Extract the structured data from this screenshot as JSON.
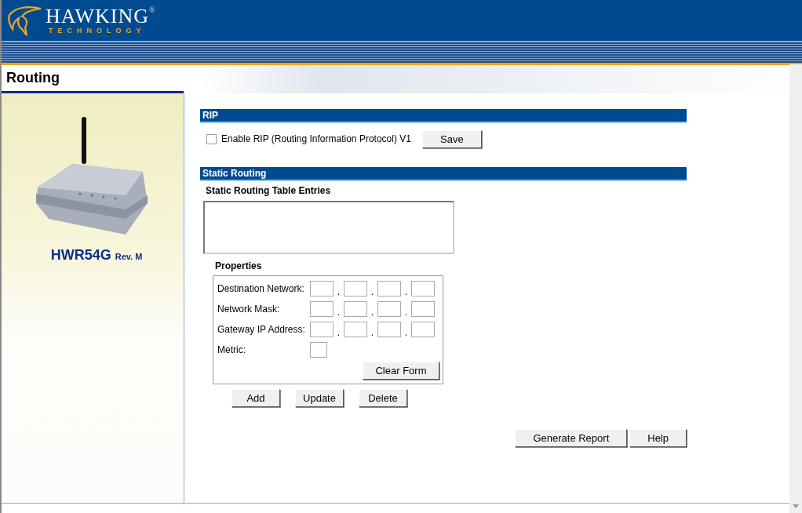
{
  "logo": {
    "brand": "HAWKING",
    "registered": "®",
    "sub": "TECHNOLOGY"
  },
  "page_title": "Routing",
  "device": {
    "model": "HWR54G",
    "revision": "Rev. M"
  },
  "rip": {
    "title": "RIP",
    "checkbox": {
      "label": "Enable RIP (Routing Information Protocol) V1",
      "checked": false
    },
    "save_button": "Save"
  },
  "static_routing": {
    "title": "Static Routing",
    "table_label": "Static Routing Table Entries",
    "properties": {
      "title": "Properties",
      "fields": [
        {
          "label": "Destination Network:",
          "kind": "ip",
          "separators": [
            ".",
            ".",
            "."
          ]
        },
        {
          "label": "Network Mask:",
          "kind": "ip",
          "separators": [
            ".",
            ".",
            "."
          ]
        },
        {
          "label": "Gateway IP Address:",
          "kind": "ip",
          "separators": [
            ".",
            ".",
            "."
          ]
        },
        {
          "label": "Metric:",
          "kind": "number"
        }
      ],
      "clear_button": "Clear Form"
    },
    "buttons": [
      "Add",
      "Update",
      "Delete"
    ]
  },
  "footer_buttons": [
    "Generate Report",
    "Help"
  ]
}
